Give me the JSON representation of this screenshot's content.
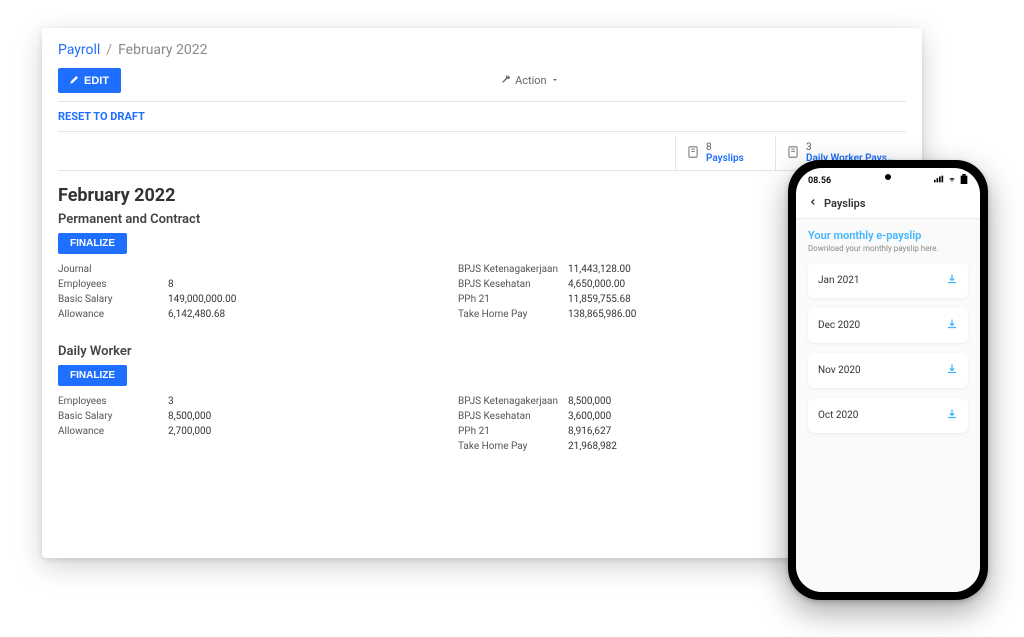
{
  "breadcrumb": {
    "parent": "Payroll",
    "current": "February 2022"
  },
  "toolbar": {
    "edit_label": "EDIT",
    "action_label": "Action"
  },
  "reset_label": "RESET TO DRAFT",
  "tabs": {
    "payslips": {
      "count": "8",
      "label": "Payslips"
    },
    "daily": {
      "count": "3",
      "label": "Daily Worker Paysli..."
    }
  },
  "period_title": "February 2022",
  "sections": {
    "permanent": {
      "title": "Permanent and Contract",
      "finalize": "FINALIZE",
      "left": {
        "journal_label": "Journal",
        "employees_label": "Employees",
        "employees_value": "8",
        "basic_salary_label": "Basic Salary",
        "basic_salary_value": "149,000,000.00",
        "allowance_label": "Allowance",
        "allowance_value": "6,142,480.68"
      },
      "right": {
        "bpjs_k_label": "BPJS Ketenagakerjaan",
        "bpjs_k_value": "11,443,128.00",
        "bpjs_kes_label": "BPJS Kesehatan",
        "bpjs_kes_value": "4,650,000.00",
        "pph_label": "PPh 21",
        "pph_value": "11,859,755.68",
        "take_home_label": "Take Home Pay",
        "take_home_value": "138,865,986.00"
      }
    },
    "daily": {
      "title": "Daily Worker",
      "finalize": "FINALIZE",
      "left": {
        "employees_label": "Employees",
        "employees_value": "3",
        "basic_salary_label": "Basic Salary",
        "basic_salary_value": "8,500,000",
        "allowance_label": "Allowance",
        "allowance_value": "2,700,000"
      },
      "right": {
        "bpjs_k_label": "BPJS Ketenagakerjaan",
        "bpjs_k_value": "8,500,000",
        "bpjs_kes_label": "BPJS Kesehatan",
        "bpjs_kes_value": "3,600,000",
        "pph_label": "PPh 21",
        "pph_value": "8,916,627",
        "take_home_label": "Take Home Pay",
        "take_home_value": "21,968,982"
      }
    }
  },
  "phone": {
    "time": "08.56",
    "header": "Payslips",
    "title": "Your monthly e-payslip",
    "subtitle": "Download your monthly payslip here.",
    "items": [
      "Jan 2021",
      "Dec 2020",
      "Nov 2020",
      "Oct 2020"
    ]
  }
}
